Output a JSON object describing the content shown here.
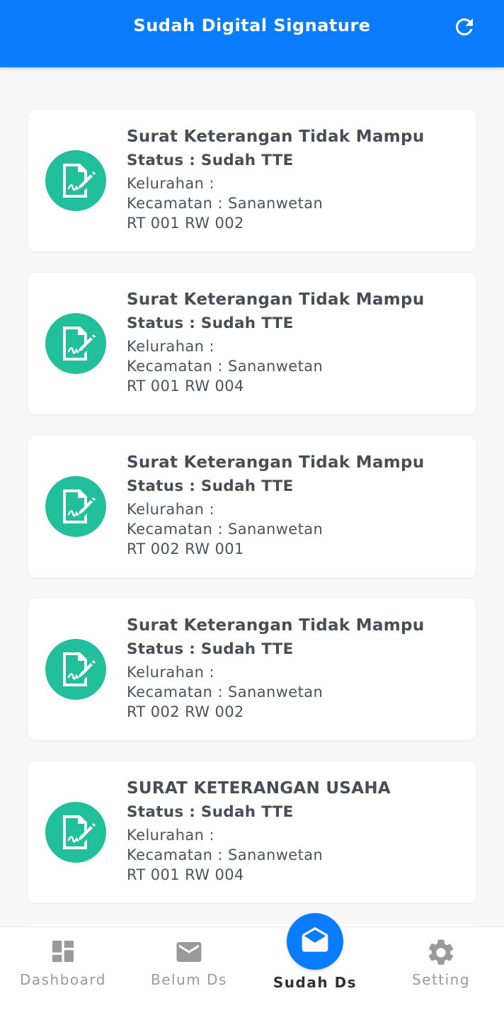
{
  "appbar": {
    "title": "Sudah Digital Signature",
    "refresh_icon": "refresh-icon",
    "color": "#0a7cff"
  },
  "documents": [
    {
      "title": "Surat Keterangan Tidak Mampu",
      "status": "Status : Sudah TTE",
      "kelurahan": "Kelurahan :",
      "kecamatan": "Kecamatan : Sananwetan",
      "rtrw": "RT 001 RW 002"
    },
    {
      "title": "Surat Keterangan Tidak Mampu",
      "status": "Status : Sudah TTE",
      "kelurahan": "Kelurahan :",
      "kecamatan": "Kecamatan : Sananwetan",
      "rtrw": "RT 001 RW 004"
    },
    {
      "title": "Surat Keterangan Tidak Mampu",
      "status": "Status : Sudah TTE",
      "kelurahan": "Kelurahan :",
      "kecamatan": "Kecamatan : Sananwetan",
      "rtrw": "RT 002 RW 001"
    },
    {
      "title": "Surat Keterangan Tidak Mampu",
      "status": "Status : Sudah TTE",
      "kelurahan": "Kelurahan :",
      "kecamatan": "Kecamatan : Sananwetan",
      "rtrw": "RT 002 RW 002"
    },
    {
      "title": "SURAT KETERANGAN USAHA",
      "status": "Status : Sudah TTE",
      "kelurahan": "Kelurahan :",
      "kecamatan": "Kecamatan : Sananwetan",
      "rtrw": "RT 001 RW 004"
    }
  ],
  "document_icon": "document-signature-icon",
  "icon_color": "#21bf9b",
  "bottom_nav": {
    "items": [
      {
        "label": "Dashboard",
        "icon": "dashboard-icon"
      },
      {
        "label": "Belum Ds",
        "icon": "mail-icon"
      },
      {
        "label": "Sudah Ds",
        "icon": "mail-open-icon",
        "active": true
      },
      {
        "label": "Setting",
        "icon": "gear-icon"
      }
    ]
  }
}
